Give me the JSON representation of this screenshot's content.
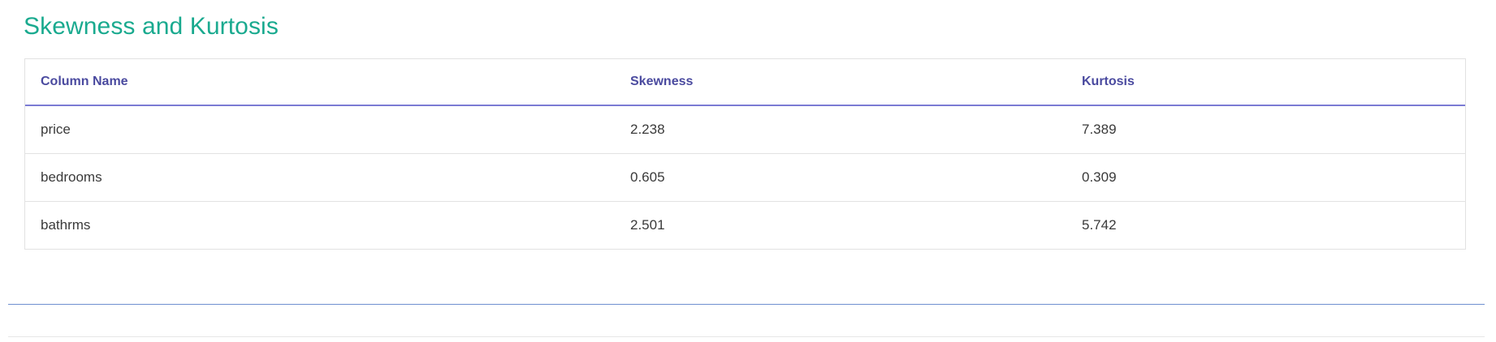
{
  "section": {
    "title": "Skewness and Kurtosis"
  },
  "table": {
    "headers": [
      "Column Name",
      "Skewness",
      "Kurtosis"
    ],
    "rows": [
      [
        "price",
        "2.238",
        "7.389"
      ],
      [
        "bedrooms",
        "0.605",
        "0.309"
      ],
      [
        "bathrms",
        "2.501",
        "5.742"
      ]
    ]
  },
  "colors": {
    "title": "#1aaa8f",
    "header_text": "#4a4a9f",
    "header_rule": "#7b7bd4",
    "divider": "#6f8fd0"
  }
}
